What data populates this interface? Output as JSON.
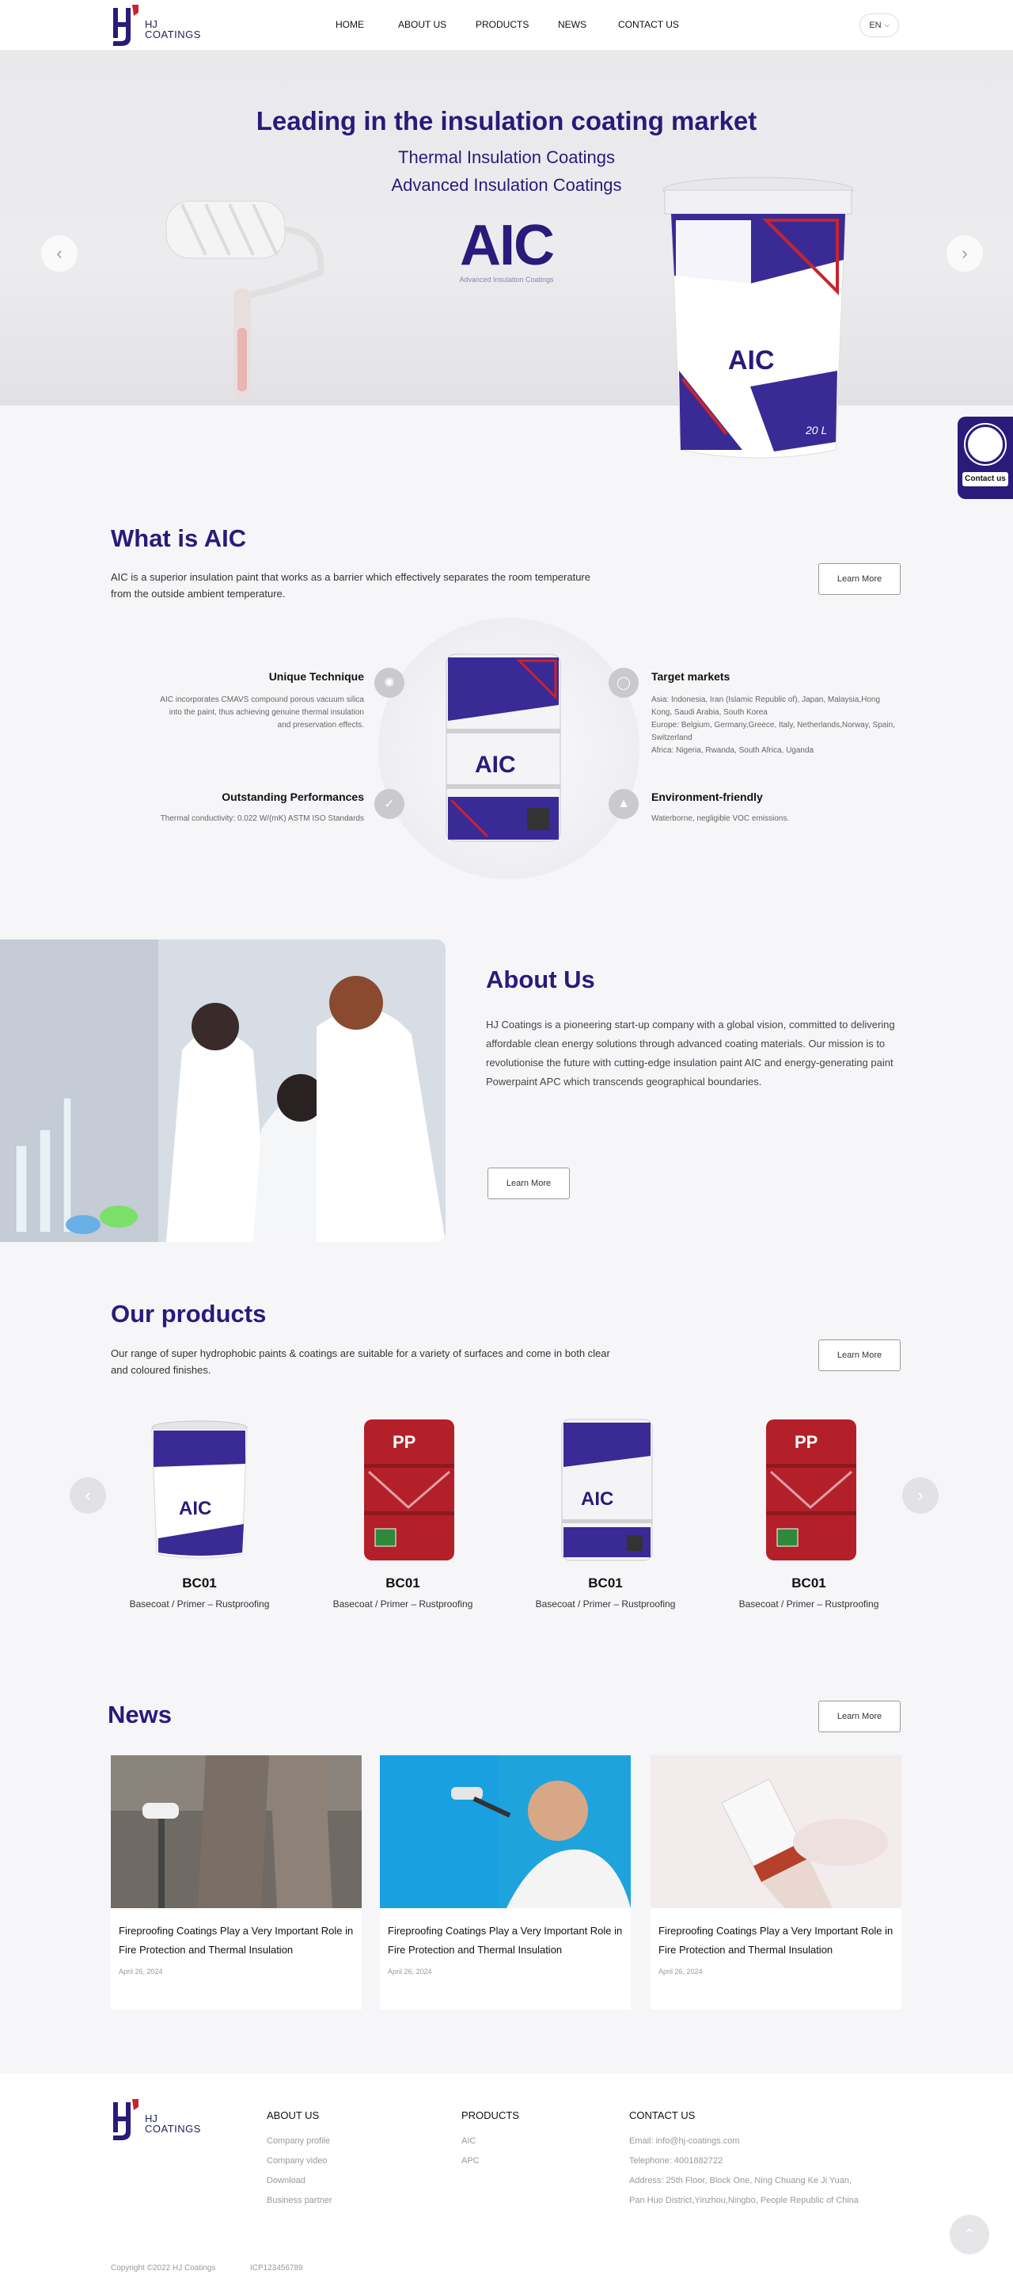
{
  "brand": {
    "line1": "HJ",
    "line2": "COATINGS"
  },
  "nav": {
    "items": [
      "HOME",
      "ABOUT US",
      "PRODUCTS",
      "NEWS",
      "CONTACT US"
    ],
    "lang": "EN"
  },
  "hero": {
    "title": "Leading in the insulation coating market",
    "sub1": "Thermal Insulation Coatings",
    "sub2": "Advanced Insulation Coatings",
    "logo_text": "AIC",
    "logo_caption": "Advanced Insulation Coatings",
    "bucket_size": "20 L"
  },
  "float_contact": {
    "label": "Contact us"
  },
  "aic": {
    "title": "What is AIC",
    "desc": "AIC is a superior insulation paint that works as a barrier which effectively separates the room temperature from the outside ambient temperature.",
    "learn_more": "Learn More",
    "features": [
      {
        "title": "Unique Technique",
        "text": "AIC incorporates CMAVS compound porous vacuum silica into the paint, thus achieving genuine thermal insulation and preservation effects."
      },
      {
        "title": "Target markets",
        "text": "Asia: Indonesia, Iran (Islamic Republic of), Japan, Malaysia,Hong Kong, Saudi Arabia, South Korea\nEurope: Belgium, Germany,Greece, Italy, Netherlands,Norway, Spain, Switzerland\nAfrica: Nigeria, Rwanda, South Africa, Uganda"
      },
      {
        "title": "Outstanding Performances",
        "text": "Thermal conductivity: 0.022 W/(mK) ASTM ISO Standards"
      },
      {
        "title": "Environment-friendly",
        "text": "Waterborne, negligible VOC emissions."
      }
    ]
  },
  "about": {
    "title": "About Us",
    "text": "HJ Coatings is a pioneering start-up company with a global vision, committed to delivering affordable clean energy solutions through advanced coating materials. Our mission is to revolutionise the future with cutting-edge insulation paint AIC and energy-generating paint Powerpaint APC which transcends geographical boundaries.",
    "learn_more": "Learn More"
  },
  "products": {
    "title": "Our products",
    "desc": "Our range of super hydrophobic paints & coatings are suitable for a variety of surfaces and come in both clear and coloured finishes.",
    "learn_more": "Learn More",
    "items": [
      {
        "name": "BC01",
        "desc": "Basecoat / Primer – Rustproofing"
      },
      {
        "name": "BC01",
        "desc": "Basecoat / Primer – Rustproofing"
      },
      {
        "name": "BC01",
        "desc": "Basecoat / Primer – Rustproofing"
      },
      {
        "name": "BC01",
        "desc": "Basecoat / Primer – Rustproofing"
      }
    ]
  },
  "news": {
    "title": "News",
    "learn_more": "Learn More",
    "items": [
      {
        "title": "Fireproofing Coatings Play a Very Important Role in Fire Protection and Thermal Insulation",
        "date": "April 26, 2024"
      },
      {
        "title": "Fireproofing Coatings Play a Very Important Role in Fire Protection and Thermal Insulation",
        "date": "April 26, 2024"
      },
      {
        "title": "Fireproofing Coatings Play a Very Important Role in Fire Protection and Thermal Insulation",
        "date": "April 26, 2024"
      }
    ]
  },
  "footer": {
    "about_head": "ABOUT US",
    "about_links": [
      "Company profile",
      "Company video",
      "Download",
      "Business partner"
    ],
    "products_head": "PRODUCTS",
    "product_links": [
      "AIC",
      "APC"
    ],
    "contact_head": "CONTACT US",
    "email": "Email: info@hj-coatings.com",
    "telephone": "Telephone: 4001882722",
    "address1": "Address: 25th Floor, Block One, Ning Chuang Ke Ji Yuan,",
    "address2": "Pan Huo District,Yinzhou,Ningbo, People Republic of China",
    "copyright": "Copyright ©2022  HJ Coatings",
    "icp": "ICP123456789"
  },
  "colors": {
    "brand": "#2a1a7a",
    "accent_red": "#c8242f"
  }
}
